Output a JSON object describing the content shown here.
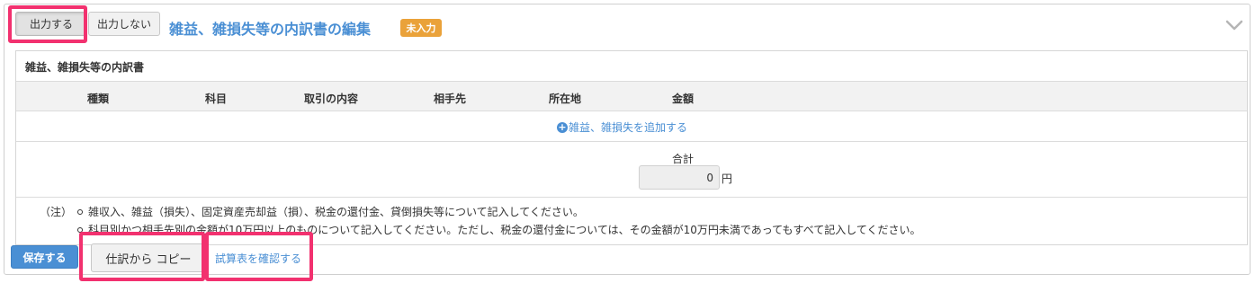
{
  "toggle": {
    "output_label": "出力する",
    "no_output_label": "出力しない"
  },
  "header": {
    "title": "雑益、雑損失等の内訳書の編集",
    "status_badge": "未入力",
    "collapse_icon": "chevron-down-icon"
  },
  "section": {
    "title": "雑益、雑損失等の内訳書",
    "columns": [
      "種類",
      "科目",
      "取引の内容",
      "相手先",
      "所在地",
      "金額"
    ],
    "add_label": "雑益、雑損失を追加する",
    "total_label": "合計",
    "total_value": "0",
    "total_unit": "円"
  },
  "notes": {
    "head": "（注）",
    "items": [
      "雑収入、雑益（損失）、固定資産売却益（損）、税金の還付金、貸倒損失等について記入してください。",
      "科目別かつ相手先別の金額が10万円以上のものについて記入してください。ただし、税金の還付金については、その金額が10万円未満であってもすべて記入してください。"
    ]
  },
  "footer": {
    "save_label": "保存する",
    "copy_label": "仕訳から コピー",
    "trial_balance_link": "試算表を確認する"
  },
  "colors": {
    "accent": "#4a8fd4",
    "badge": "#eaa23a",
    "highlight": "#f2316f"
  }
}
